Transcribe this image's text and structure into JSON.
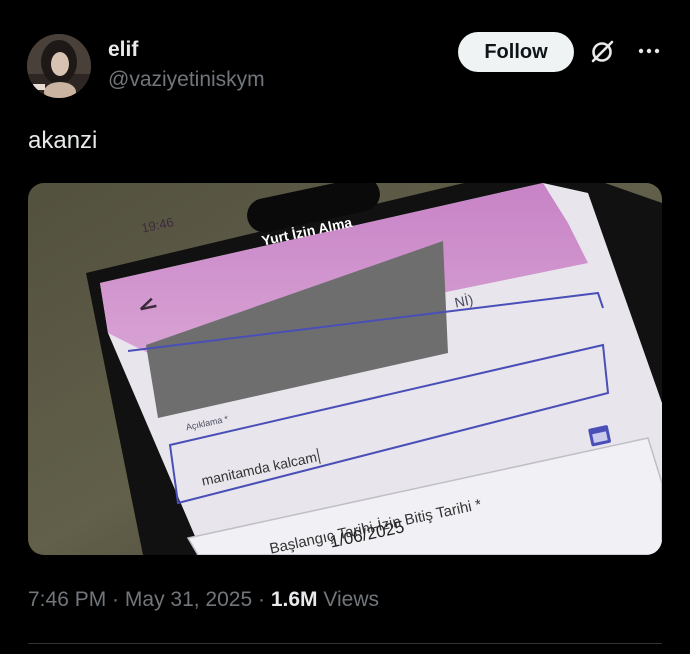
{
  "author": {
    "name": "elif",
    "handle": "@vaziyetiniskym"
  },
  "actions": {
    "follow_label": "Follow"
  },
  "icons": {
    "grok": "grok-icon",
    "more": "more-options-icon"
  },
  "tweet": {
    "text": "akanzi",
    "time": "7:46 PM",
    "sep1": " · ",
    "date": "May 31, 2025",
    "sep2": " · ",
    "views_count": "1.6M",
    "views_label": " Views"
  },
  "media": {
    "status_time": "19:46",
    "screen_title": "Yurt İzin Alma",
    "partial_label": "Nİ)",
    "field_label": "Açıklama *",
    "field_value": "manitamda kalcam",
    "date_label": "Başlangıç Tarihi-İzin Bitiş Tarihi *",
    "date_value": "1/06/2025"
  },
  "colors": {
    "background": "#000000",
    "text_primary": "#e7e9ea",
    "text_secondary": "#71767b",
    "follow_bg": "#eff3f4",
    "app_header_purple": "#c98fc8",
    "app_accent": "#4a4fb8"
  }
}
